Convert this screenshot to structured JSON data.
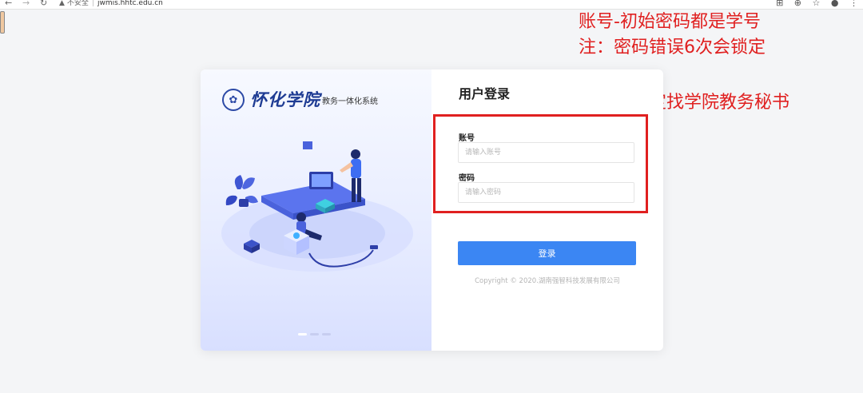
{
  "browser": {
    "back_icon": "arrow-left-icon",
    "forward_icon": "arrow-right-icon",
    "reload_icon": "reload-icon",
    "security_label": "不安全",
    "url": "jwmis.hhtc.edu.cn"
  },
  "annotations": {
    "line1": "账号-初始密码都是学号",
    "line2": "注：密码错误6次会锁定",
    "line3": "密码和锁定找学院教务秘书",
    "color": "#e02020"
  },
  "branding": {
    "logo_text": "怀化学院",
    "system_name": "教务一体化系统"
  },
  "login": {
    "title": "用户登录",
    "account_label": "账号",
    "account_placeholder": "请输入账号",
    "password_label": "密码",
    "password_placeholder": "请输入密码",
    "submit_label": "登录",
    "copyright": "Copyright © 2020.湖南强智科技发展有限公司"
  },
  "carousel": {
    "count": 3,
    "active_index": 0
  },
  "colors": {
    "accent": "#3b86f3",
    "brand": "#1e3b93",
    "highlight": "#e02020"
  }
}
